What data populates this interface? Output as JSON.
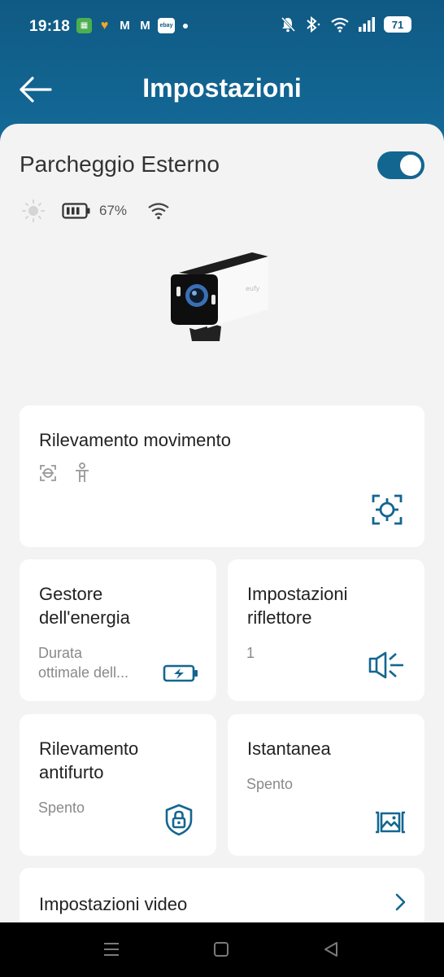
{
  "status_bar": {
    "time": "19:18",
    "battery": "71",
    "notification_icons": [
      "app-green-icon",
      "app-orange-icon",
      "gmail-icon",
      "gmail-icon",
      "ebay-icon"
    ],
    "ebay_label": "ebay"
  },
  "header": {
    "title": "Impostazioni"
  },
  "device": {
    "name": "Parcheggio Esterno",
    "enabled": true,
    "battery_percent": "67%"
  },
  "cards": {
    "motion": {
      "title": "Rilevamento movimento"
    },
    "energy": {
      "title_line1": "Gestore",
      "title_line2": "dell'energia",
      "sub_line1": "Durata",
      "sub_line2": "ottimale dell..."
    },
    "spotlight": {
      "title_line1": "Impostazioni",
      "title_line2": "riflettore",
      "value": "1"
    },
    "antitheft": {
      "title_line1": "Rilevamento",
      "title_line2": "antifurto",
      "value": "Spento"
    },
    "snapshot": {
      "title": "Istantanea",
      "value": "Spento"
    },
    "video": {
      "title": "Impostazioni video"
    }
  },
  "colors": {
    "header_bg": "#0f5a84",
    "accent": "#136690",
    "card_bg": "#ffffff",
    "page_bg": "#f3f3f3"
  }
}
